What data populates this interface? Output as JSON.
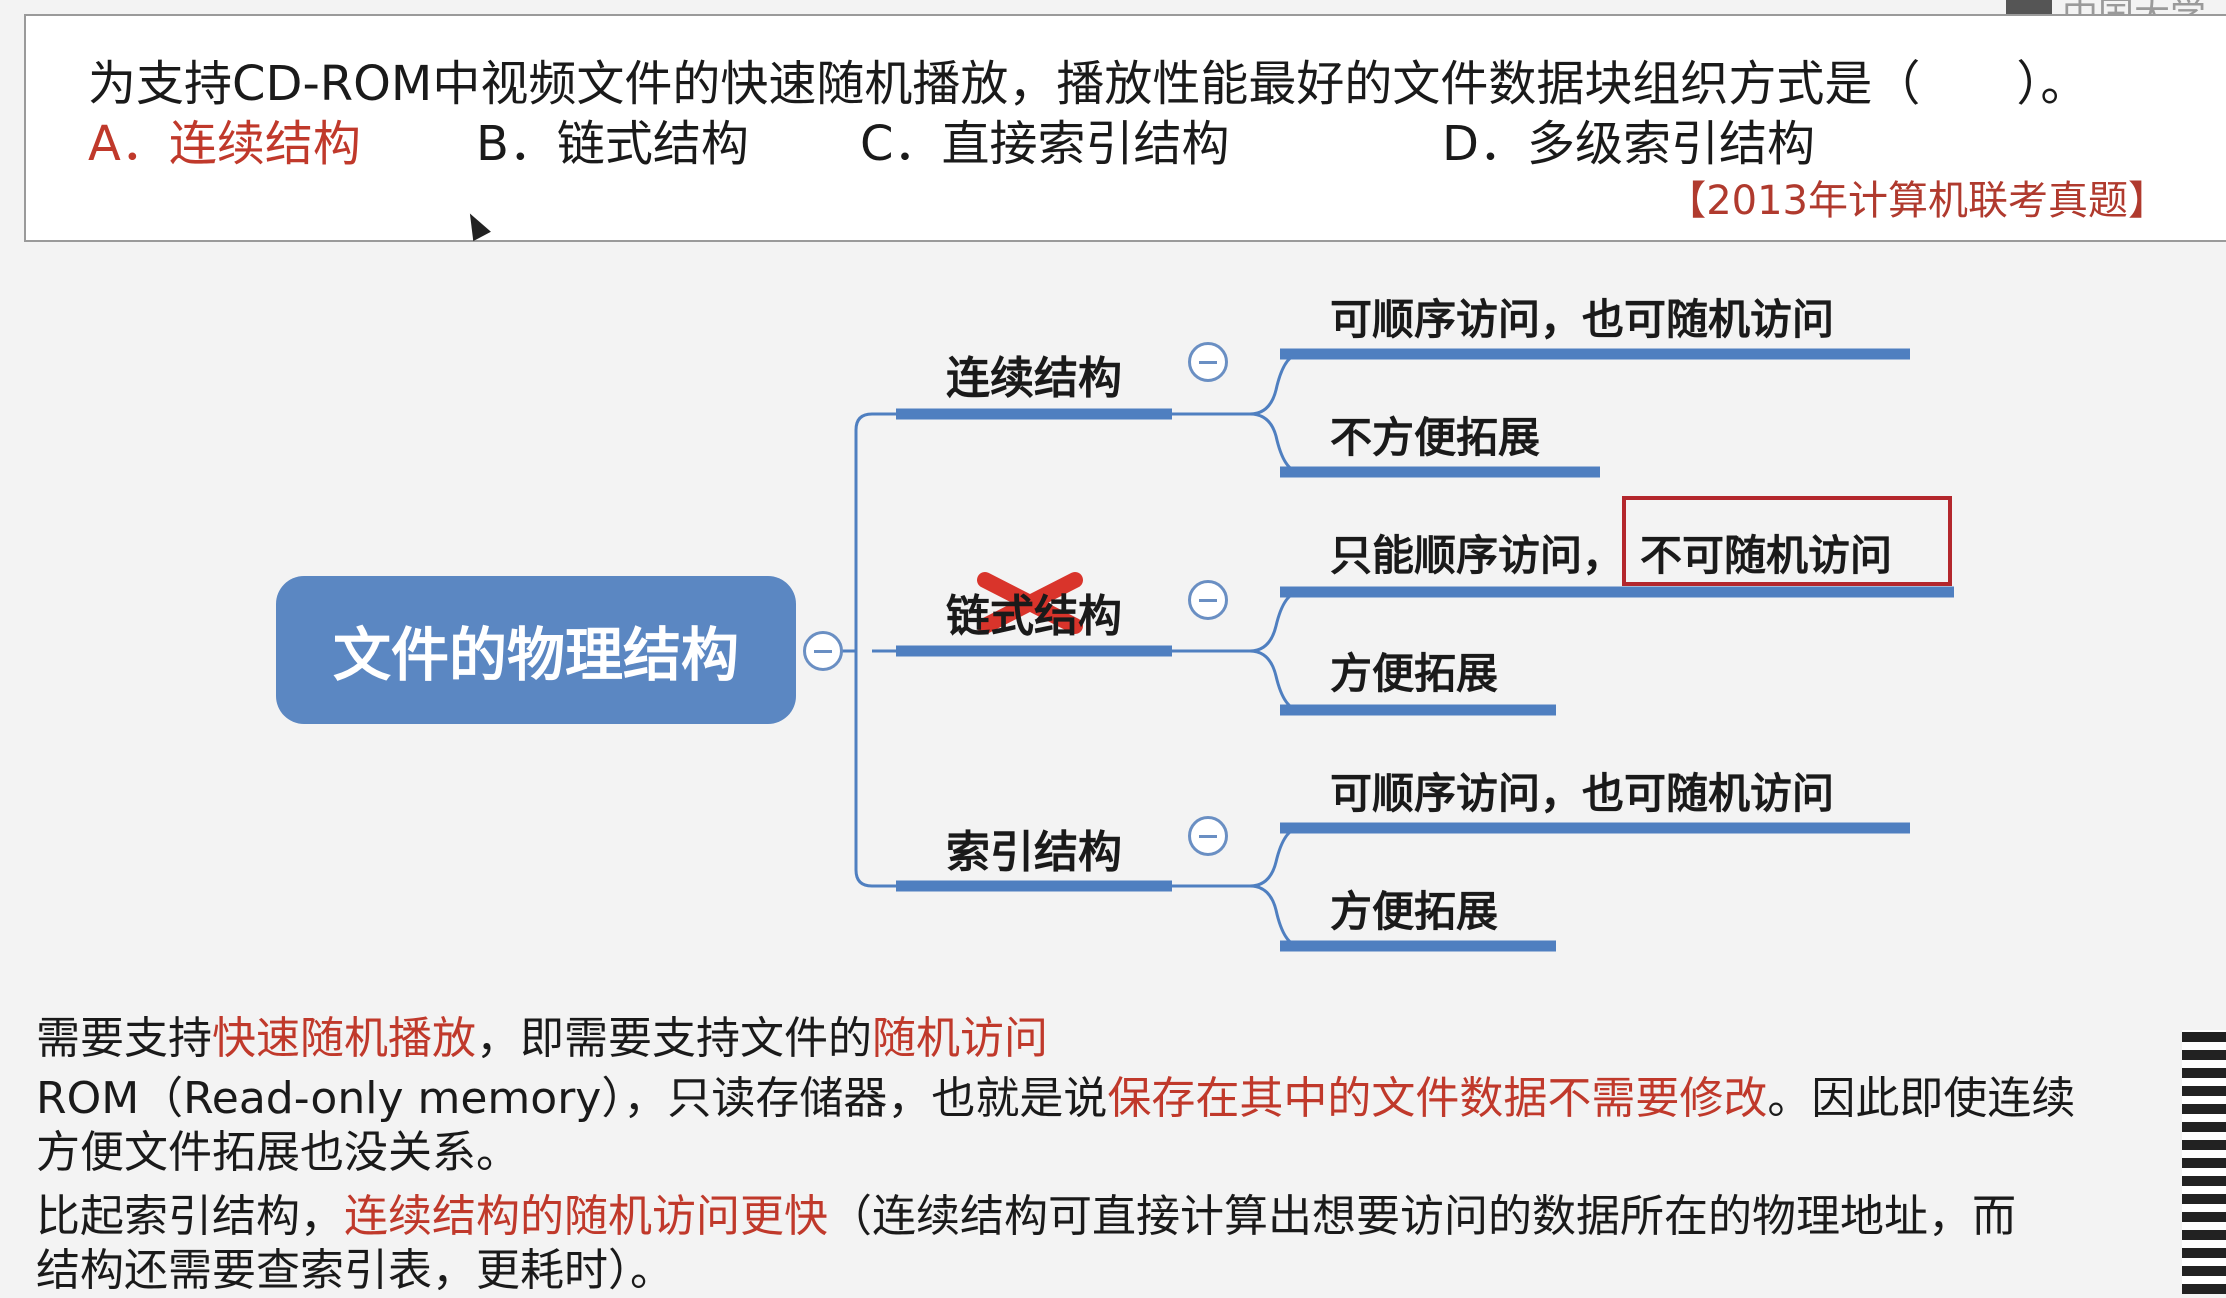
{
  "question": {
    "stem": "为支持CD-ROM中视频文件的快速随机播放，播放性能最好的文件数据块组织方式是（　　）。",
    "options": [
      {
        "label": "A．连续结构",
        "correct": true
      },
      {
        "label": "B．链式结构",
        "correct": false
      },
      {
        "label": "C．直接索引结构",
        "correct": false
      },
      {
        "label": "D．多级索引结构",
        "correct": false
      }
    ],
    "source": "【2013年计算机联考真题】"
  },
  "logo": {
    "text": "中国大学"
  },
  "mindmap": {
    "root": "文件的物理结构",
    "branches": [
      {
        "label": "连续结构",
        "leaves": [
          "可顺序访问，也可随机访问",
          "不方便拓展"
        ]
      },
      {
        "label": "链式结构",
        "crossed_out": true,
        "leaves_part1": "只能顺序访问，",
        "leaves_highlight": "不可随机访问",
        "leaf2": "方便拓展"
      },
      {
        "label": "索引结构",
        "leaves": [
          "可顺序访问，也可随机访问",
          "方便拓展"
        ]
      }
    ]
  },
  "explanation": {
    "line1_a": "需要支持",
    "line1_b": "快速随机播放",
    "line1_c": "，即需要支持文件的",
    "line1_d": "随机访问",
    "line2_a": "ROM（Read-only memory），只读存储器，也就是说",
    "line2_b": "保存在其中的文件数据不需要修改",
    "line2_c": "。因此即使连续",
    "line3": "方便文件拓展也没关系。",
    "line4_a": "比起索引结构，",
    "line4_b": "连续结构的随机访问更快",
    "line4_c": "（连续结构可直接计算出想要访问的数据所在的物理地址，而",
    "line5": "结构还需要查索引表，更耗时）。"
  },
  "colors": {
    "accent_blue": "#5b87c2",
    "line_blue": "#4f7fc0",
    "answer_red": "#c0392b",
    "highlight_red": "#b3262c"
  }
}
